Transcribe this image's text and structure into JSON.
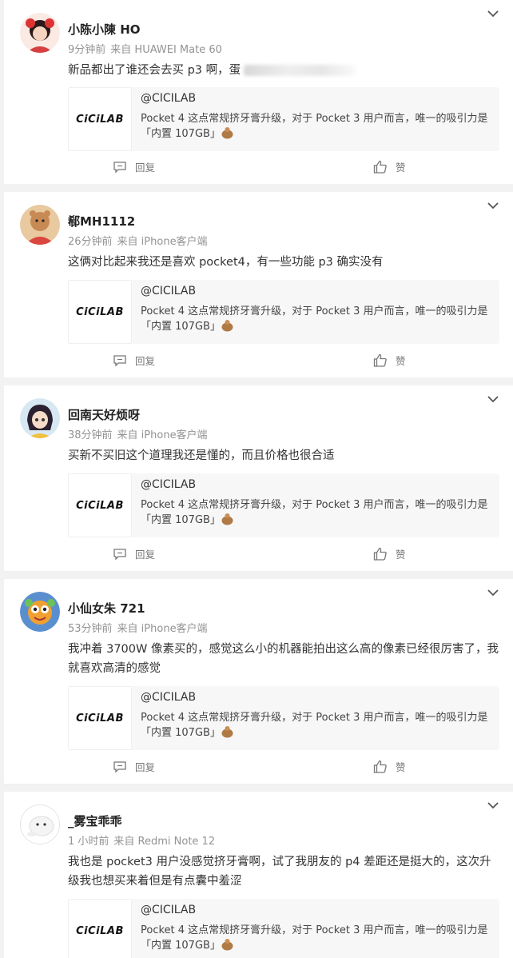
{
  "comments": [
    {
      "name": "小陈小陳 HO",
      "time": "9分钟前",
      "source": "来自 HUAWEI Mate 60",
      "text": "新品都出了谁还会去买 p3 啊，",
      "text_extra": "蛋",
      "quote_handle": "@CICILAB",
      "quote_text": "Pocket 4 这点常规挤牙膏升级，对于 Pocket 3 用户而言，唯一的吸引力是「内置 107GB」",
      "reply_label": "回复",
      "like_label": "赞"
    },
    {
      "name": "郗MH1112",
      "time": "26分钟前",
      "source": "来自 iPhone客户端",
      "text": "这俩对比起来我还是喜欢 pocket4，有一些功能 p3 确实没有",
      "quote_handle": "@CICILAB",
      "quote_text": "Pocket 4 这点常规挤牙膏升级，对于 Pocket 3 用户而言，唯一的吸引力是「内置 107GB」",
      "reply_label": "回复",
      "like_label": "赞"
    },
    {
      "name": "回南天好烦呀",
      "time": "38分钟前",
      "source": "来自 iPhone客户端",
      "text": "买新不买旧这个道理我还是懂的，而且价格也很合适",
      "quote_handle": "@CICILAB",
      "quote_text": "Pocket 4 这点常规挤牙膏升级，对于 Pocket 3 用户而言，唯一的吸引力是「内置 107GB」",
      "reply_label": "回复",
      "like_label": "赞"
    },
    {
      "name": "小仙女朱 721",
      "time": "53分钟前",
      "source": "来自 iPhone客户端",
      "text": "我冲着 3700W 像素买的，感觉这么小的机器能拍出这么高的像素已经很厉害了，我就喜欢高清的感觉",
      "quote_handle": "@CICILAB",
      "quote_text": "Pocket 4 这点常规挤牙膏升级，对于 Pocket 3 用户而言，唯一的吸引力是「内置 107GB」",
      "reply_label": "回复",
      "like_label": "赞"
    },
    {
      "name": "_雾宝乖乖",
      "time": "1 小时前",
      "source": "来自 Redmi Note 12",
      "text": "我也是 pocket3 用户没感觉挤牙膏啊，试了我朋友的 p4 差距还是挺大的，这次升级我也想买来着但是有点囊中羞涩",
      "quote_handle": "@CICILAB",
      "quote_text": "Pocket 4 这点常规挤牙膏升级，对于 Pocket 3 用户而言，唯一的吸引力是「内置 107GB」",
      "reply_label": "回复",
      "like_label": "赞"
    }
  ],
  "quote_logo": "CiCiLAB",
  "icons": {
    "menu": "chevron-down-icon",
    "reply": "comment-icon",
    "like": "thumbs-up-icon",
    "emoji": "bag-emoji-icon"
  },
  "colors": {
    "meta": "#939393",
    "page_bg": "#f2f2f2",
    "quote_bg": "#f7f7f7"
  }
}
